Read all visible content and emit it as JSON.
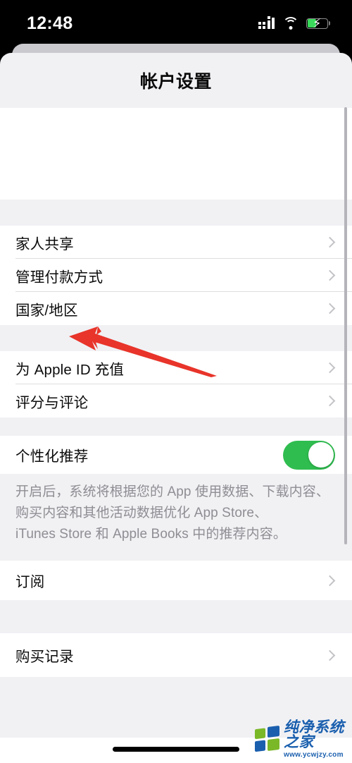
{
  "status_bar": {
    "time": "12:48",
    "cellular_icon": "cellular-signal-icon",
    "wifi_icon": "wifi-icon",
    "battery_icon": "battery-charging-icon"
  },
  "sheet": {
    "title": "帐户设置"
  },
  "sections": [
    {
      "name": "account-header-section",
      "blank": true,
      "rows": []
    },
    {
      "name": "account-management-section",
      "rows": [
        {
          "label": "家人共享",
          "accessory": "chevron"
        },
        {
          "label": "管理付款方式",
          "accessory": "chevron"
        },
        {
          "label": "国家/地区",
          "accessory": "chevron"
        }
      ]
    },
    {
      "name": "funds-and-reviews-section",
      "rows": [
        {
          "label": "为 Apple ID 充值",
          "accessory": "chevron"
        },
        {
          "label": "评分与评论",
          "accessory": "chevron"
        }
      ]
    },
    {
      "name": "personalized-recommendations-section",
      "rows": [
        {
          "label": "个性化推荐",
          "accessory": "toggle",
          "toggle_on": true
        }
      ],
      "footer_lines": [
        "开启后，系统将根据您的 App 使用数据、下载内容、",
        "购买内容和其他活动数据优化 App Store、",
        "iTunes Store 和 Apple Books 中的推荐内容。"
      ]
    },
    {
      "name": "subscriptions-section",
      "rows": [
        {
          "label": "订阅",
          "accessory": "chevron"
        }
      ]
    },
    {
      "name": "purchase-history-section",
      "rows": [
        {
          "label": "购买记录",
          "accessory": "chevron"
        }
      ]
    }
  ],
  "annotation": {
    "arrow_icon": "red-arrow-annotation",
    "color": "#E8342A",
    "points_at": "国家/地区"
  },
  "watermark": {
    "title": "纯净系统之家",
    "url": "www.ycwjzy.com",
    "logo_icon": "four-square-logo-icon",
    "brand_blue": "#1A5FAE",
    "brand_green": "#7AB828"
  },
  "home_indicator": {
    "icon": "home-indicator"
  },
  "colors": {
    "toggle_on": "#2FBD4F",
    "sheet_background": "#F1F1F4",
    "row_background": "#FFFFFF",
    "chevron": "#C3C3C7",
    "footer_text": "#8E8E93"
  }
}
